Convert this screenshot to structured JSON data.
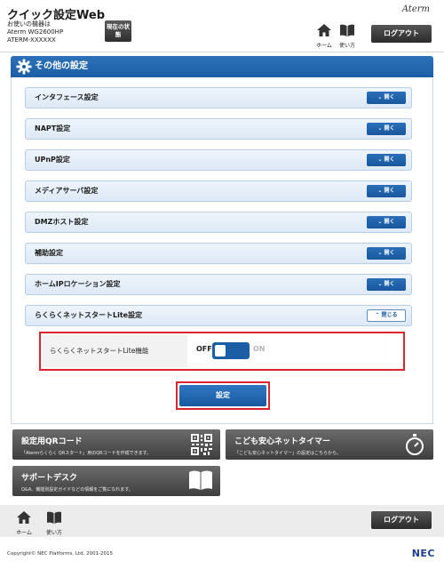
{
  "header": {
    "app_title": "クイック設定Web",
    "model_caption": "お使いの機器は",
    "model_name": "Aterm WG2600HP",
    "model_ssid": "ATERM-XXXXXX",
    "status_button": "現在の状態",
    "brand": "Aterm",
    "home_label": "ホーム",
    "usage_label": "使い方",
    "logout_label": "ログアウト"
  },
  "panel": {
    "title": "その他の設定",
    "sections": [
      {
        "label": "インタフェース設定",
        "button": "開く"
      },
      {
        "label": "NAPT設定",
        "button": "開く"
      },
      {
        "label": "UPnP設定",
        "button": "開く"
      },
      {
        "label": "メディアサーバ設定",
        "button": "開く"
      },
      {
        "label": "DMZホスト設定",
        "button": "開く"
      },
      {
        "label": "補助設定",
        "button": "開く"
      },
      {
        "label": "ホームIPロケーション設定",
        "button": "開く"
      },
      {
        "label": "らくらくネットスタートLite設定",
        "button": "閉じる"
      }
    ],
    "lite_function_label": "らくらくネットスタートLite機能",
    "toggle_off": "OFF",
    "toggle_on": "ON",
    "toggle_state": "OFF",
    "submit_label": "設定"
  },
  "tiles": {
    "qr": {
      "title": "設定用QRコード",
      "desc": "「Atermらくらく QRスタート」用のQRコードを作成できます。"
    },
    "timer": {
      "title": "こども安心ネットタイマー",
      "desc": "「こども安心ネットタイマー」の設定はこちらから。"
    },
    "support": {
      "title": "サポートデスク",
      "desc": "Q&A、機能別設定ガイドなどの情報をご覧になれます。"
    }
  },
  "footer": {
    "home_label": "ホーム",
    "usage_label": "使い方",
    "logout_label": "ログアウト",
    "copyright": "Copyright© NEC Platforms, Ltd. 2001-2015",
    "logo": "NEC"
  },
  "colors": {
    "accent_blue": "#1b5ea5",
    "highlight_red": "#d9262b",
    "tile_dark": "#4a4a4a"
  }
}
